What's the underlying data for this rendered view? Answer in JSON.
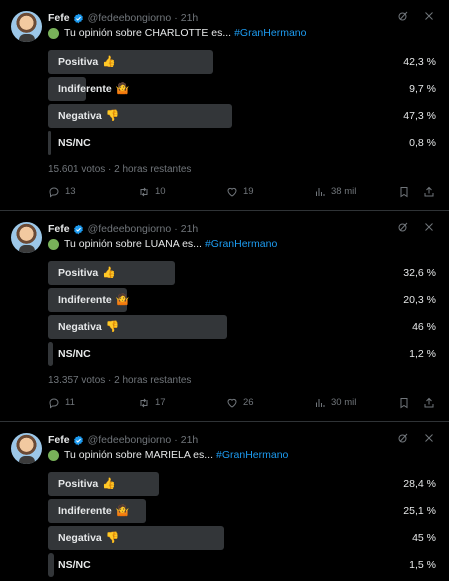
{
  "tweets": [
    {
      "author": "Fefe",
      "handle": "@fedeebongiorno",
      "time": "21h",
      "text": "Tu opinión sobre CHARLOTTE es...",
      "hashtag": "#GranHermano",
      "options": [
        {
          "label": "Positiva",
          "emoji": "👍",
          "pct": "42,3 %",
          "value": 42.3
        },
        {
          "label": "Indiferente",
          "emoji": "🤷",
          "pct": "9,7 %",
          "value": 9.7
        },
        {
          "label": "Negativa",
          "emoji": "👎",
          "pct": "47,3 %",
          "value": 47.3
        },
        {
          "label": "NS/NC",
          "emoji": "",
          "pct": "0,8 %",
          "value": 0.8
        }
      ],
      "votes": "15.601 votos",
      "remaining": "2 horas restantes",
      "replies": "13",
      "retweets": "10",
      "likes": "19",
      "views": "38 mil"
    },
    {
      "author": "Fefe",
      "handle": "@fedeebongiorno",
      "time": "21h",
      "text": "Tu opinión sobre LUANA es...",
      "hashtag": "#GranHermano",
      "options": [
        {
          "label": "Positiva",
          "emoji": "👍",
          "pct": "32,6 %",
          "value": 32.6
        },
        {
          "label": "Indiferente",
          "emoji": "🤷",
          "pct": "20,3 %",
          "value": 20.3
        },
        {
          "label": "Negativa",
          "emoji": "👎",
          "pct": "46 %",
          "value": 46
        },
        {
          "label": "NS/NC",
          "emoji": "",
          "pct": "1,2 %",
          "value": 1.2
        }
      ],
      "votes": "13.357 votos",
      "remaining": "2 horas restantes",
      "replies": "11",
      "retweets": "17",
      "likes": "26",
      "views": "30 mil"
    },
    {
      "author": "Fefe",
      "handle": "@fedeebongiorno",
      "time": "21h",
      "text": "Tu opinión sobre MARIELA es...",
      "hashtag": "#GranHermano",
      "options": [
        {
          "label": "Positiva",
          "emoji": "👍",
          "pct": "28,4 %",
          "value": 28.4
        },
        {
          "label": "Indiferente",
          "emoji": "🤷",
          "pct": "25,1 %",
          "value": 25.1
        },
        {
          "label": "Negativa",
          "emoji": "👎",
          "pct": "45 %",
          "value": 45
        },
        {
          "label": "NS/NC",
          "emoji": "",
          "pct": "1,5 %",
          "value": 1.5
        }
      ]
    }
  ],
  "colors": {
    "accent": "#1d9bf0",
    "bar": "#333639",
    "muted": "#71767b",
    "verified": "#1d9bf0"
  },
  "icons": [
    "verified-badge-icon",
    "grok-icon",
    "more-icon",
    "reply-icon",
    "retweet-icon",
    "like-icon",
    "views-icon",
    "bookmark-icon",
    "share-icon"
  ]
}
